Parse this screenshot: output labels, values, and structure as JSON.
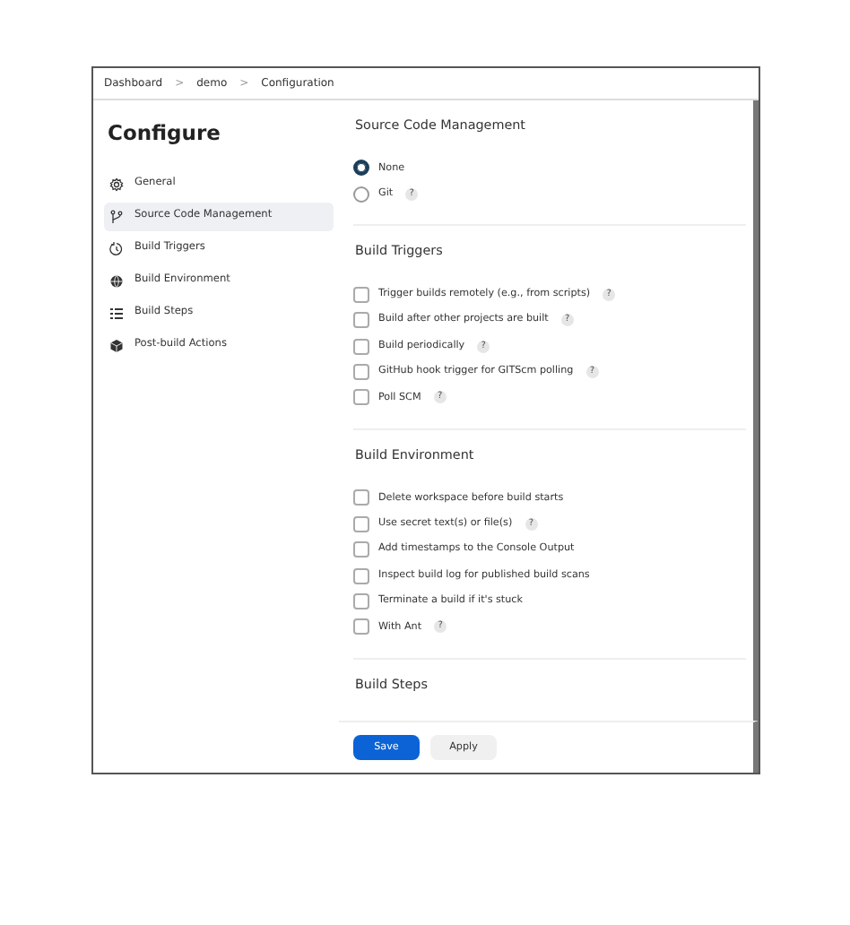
{
  "breadcrumb": [
    {
      "label": "Dashboard"
    },
    {
      "label": "demo"
    },
    {
      "label": "Configuration"
    }
  ],
  "breadcrumb_separator": ">",
  "sidebar": {
    "title": "Configure",
    "items": [
      {
        "label": "General",
        "kind": "gear",
        "selected": false
      },
      {
        "label": "Source Code Management",
        "kind": "branch",
        "selected": true
      },
      {
        "label": "Build Triggers",
        "kind": "clock",
        "selected": false
      },
      {
        "label": "Build Environment",
        "kind": "globe",
        "selected": false
      },
      {
        "label": "Build Steps",
        "kind": "list",
        "selected": false
      },
      {
        "label": "Post-build Actions",
        "kind": "box",
        "selected": false
      }
    ]
  },
  "sections": [
    {
      "title": "Source Code Management",
      "options": [
        {
          "kind": "radio",
          "label": "None",
          "checked": true
        },
        {
          "kind": "radio",
          "label": "Git",
          "checked": false,
          "help": "?"
        }
      ]
    },
    {
      "title": "Build Triggers",
      "options": [
        {
          "kind": "checkbox",
          "label": "Trigger builds remotely (e.g., from scripts)",
          "checked": false,
          "help": "?"
        },
        {
          "kind": "checkbox",
          "label": "Build after other projects are built",
          "checked": false,
          "help": "?"
        },
        {
          "kind": "checkbox",
          "label": "Build periodically",
          "checked": false,
          "help": "?"
        },
        {
          "kind": "checkbox",
          "label": "GitHub hook trigger for GITScm polling",
          "checked": false,
          "help": "?"
        },
        {
          "kind": "checkbox",
          "label": "Poll SCM",
          "checked": false,
          "help": "?"
        }
      ]
    },
    {
      "title": "Build Environment",
      "options": [
        {
          "kind": "checkbox",
          "label": "Delete workspace before build starts",
          "checked": false
        },
        {
          "kind": "checkbox",
          "label": "Use secret text(s) or file(s)",
          "checked": false,
          "help": "?"
        },
        {
          "kind": "checkbox",
          "label": "Add timestamps to the Console Output",
          "checked": false
        },
        {
          "kind": "checkbox",
          "label": "Inspect build log for published build scans",
          "checked": false
        },
        {
          "kind": "checkbox",
          "label": "Terminate a build if it's stuck",
          "checked": false
        },
        {
          "kind": "checkbox",
          "label": "With Ant",
          "checked": false,
          "help": "?"
        }
      ]
    },
    {
      "title": "Build Steps"
    }
  ],
  "buttons": [
    {
      "label": "Save",
      "kind": "primary"
    },
    {
      "label": "Apply",
      "kind": "secondary"
    }
  ]
}
